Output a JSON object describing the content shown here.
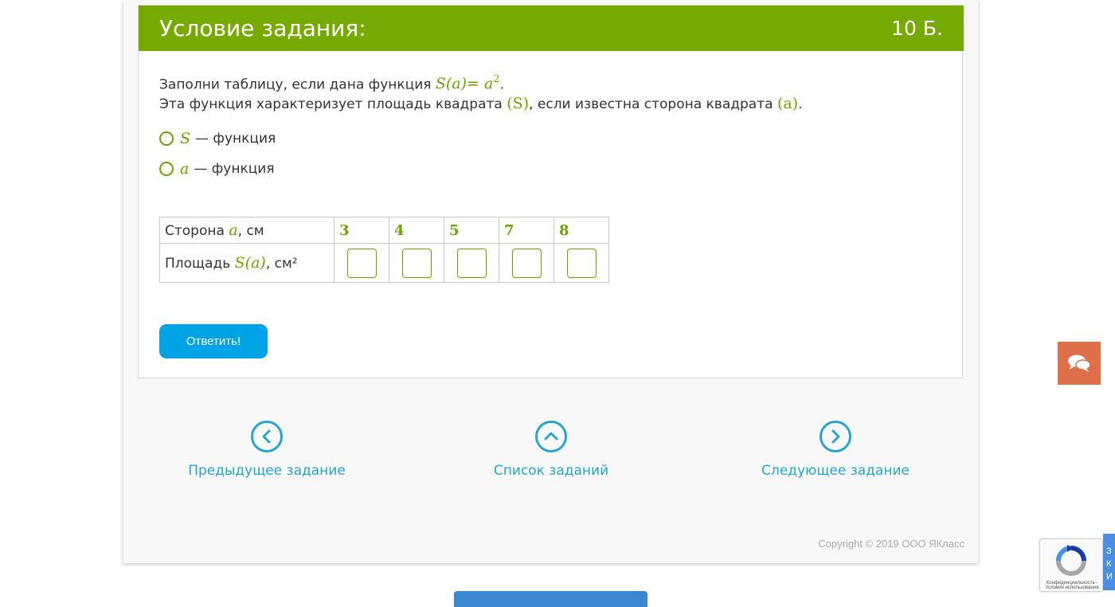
{
  "task": {
    "title": "Условие задания:",
    "points": "10 Б.",
    "line1_text": "Заполни таблицу, если дана функция ",
    "line1_formula_base": "S(a)= a",
    "line1_formula_exp": "2",
    "line1_end": ".",
    "line2_text": "Эта функция характеризует площадь квадрата ",
    "line2_var1": "(S)",
    "line2_mid": ", если известна сторона квадрата ",
    "line2_var2": "(a)",
    "line2_end": "."
  },
  "options": [
    {
      "var": "S",
      "text": "— функция"
    },
    {
      "var": "a",
      "text": "— функция"
    }
  ],
  "table": {
    "row1_label_prefix": "Сторона ",
    "row1_label_var": "a",
    "row1_label_suffix": ", см",
    "row2_label_prefix": "Площадь ",
    "row2_label_var": "S(a)",
    "row2_label_suffix": ", см²",
    "values": [
      "3",
      "4",
      "5",
      "7",
      "8"
    ],
    "answers": [
      "",
      "",
      "",
      "",
      ""
    ]
  },
  "submit_label": "Ответить!",
  "nav": {
    "prev_label": "Предыдущее задание",
    "list_label": "Список заданий",
    "next_label": "Следующее задание"
  },
  "copyright": "Copyright © 2019 ООО ЯКласс",
  "recaptcha_text": "Конфиденциальность - Условия использования",
  "side_tab_text": "З К И",
  "colors": {
    "header_green": "#77aa00",
    "math_green": "#6aa300",
    "button_blue": "#00a3e6",
    "link_blue": "#29a3cf",
    "feedback_orange": "#de6f48"
  }
}
